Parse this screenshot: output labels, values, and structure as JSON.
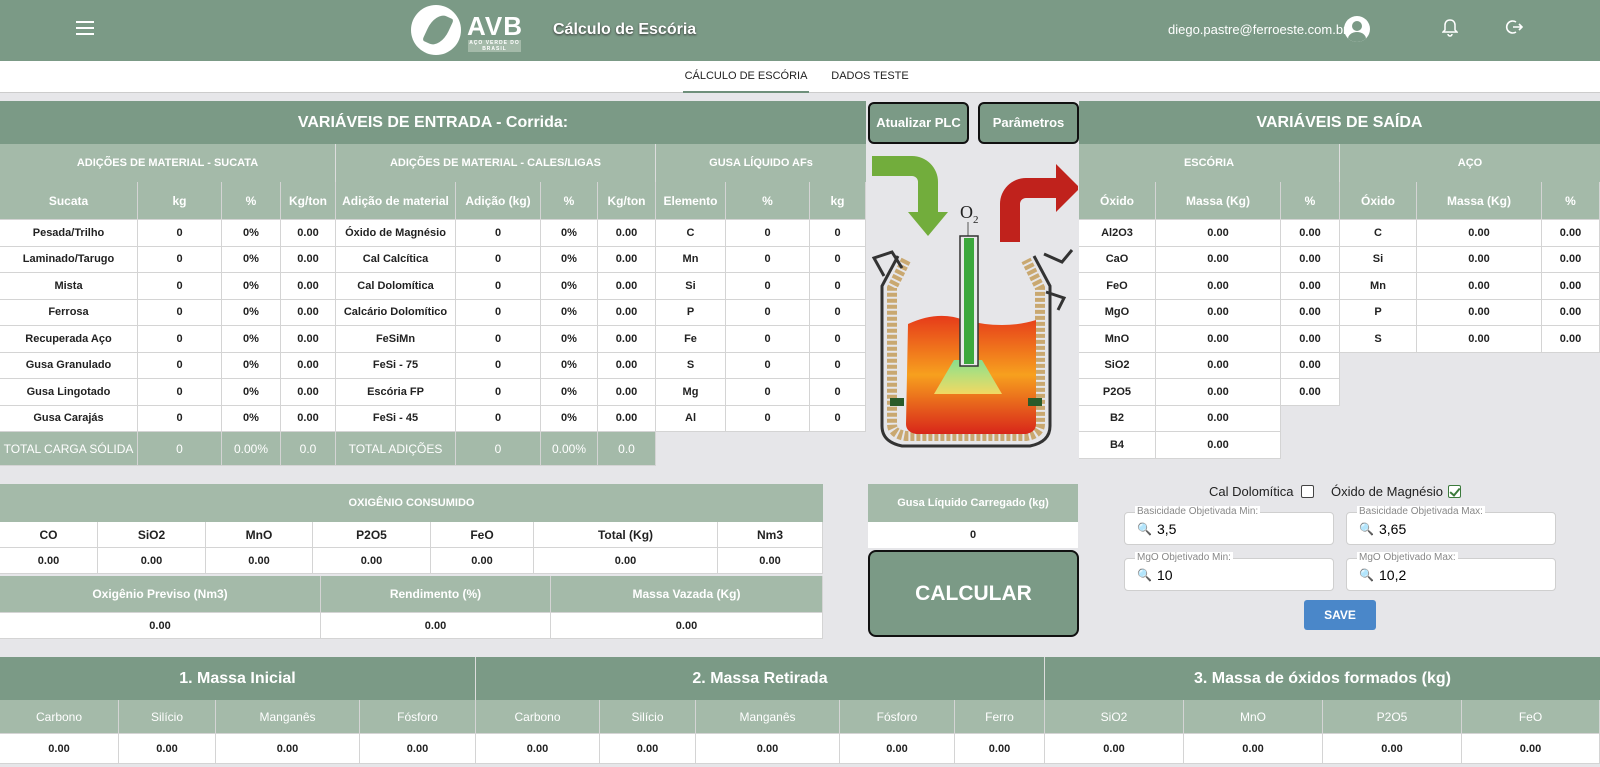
{
  "header": {
    "app_title": "Cálculo de Escória",
    "brand": "AVB",
    "brand_sub": "AÇO VERDE DO BRASIL",
    "user_email": "diego.pastre@ferroeste.com.br"
  },
  "tabs": [
    {
      "label": "CÁLCULO DE ESCÓRIA"
    },
    {
      "label": "DADOS TESTE"
    }
  ],
  "inputs": {
    "title": "VARIÁVEIS DE ENTRADA - Corrida:",
    "sucata": {
      "title": "ADIÇÕES DE MATERIAL - SUCATA",
      "cols": [
        "Sucata",
        "kg",
        "%",
        "Kg/ton"
      ],
      "rows": [
        [
          "Pesada/Trilho",
          "0",
          "0%",
          "0.00"
        ],
        [
          "Laminado/Tarugo",
          "0",
          "0%",
          "0.00"
        ],
        [
          "Mista",
          "0",
          "0%",
          "0.00"
        ],
        [
          "Ferrosa",
          "0",
          "0%",
          "0.00"
        ],
        [
          "Recuperada Aço",
          "0",
          "0%",
          "0.00"
        ],
        [
          "Gusa Granulado",
          "0",
          "0%",
          "0.00"
        ],
        [
          "Gusa Lingotado",
          "0",
          "0%",
          "0.00"
        ],
        [
          "Gusa Carajás",
          "0",
          "0%",
          "0.00"
        ]
      ],
      "total": [
        "TOTAL CARGA SÓLIDA",
        "0",
        "0.00%",
        "0.0"
      ]
    },
    "cales": {
      "title": "ADIÇÕES DE MATERIAL - CALES/LIGAS",
      "cols": [
        "Adição de material",
        "Adição (kg)",
        "%",
        "Kg/ton"
      ],
      "rows": [
        [
          "Óxido de Magnésio",
          "0",
          "0%",
          "0.00"
        ],
        [
          "Cal Calcítica",
          "0",
          "0%",
          "0.00"
        ],
        [
          "Cal Dolomítica",
          "0",
          "0%",
          "0.00"
        ],
        [
          "Calcário Dolomítico",
          "0",
          "0%",
          "0.00"
        ],
        [
          "FeSiMn",
          "0",
          "0%",
          "0.00"
        ],
        [
          "FeSi - 75",
          "0",
          "0%",
          "0.00"
        ],
        [
          "Escória FP",
          "0",
          "0%",
          "0.00"
        ],
        [
          "FeSi - 45",
          "0",
          "0%",
          "0.00"
        ]
      ],
      "total": [
        "TOTAL ADIÇÕES",
        "0",
        "0.00%",
        "0.0"
      ]
    },
    "gusa": {
      "title": "GUSA LÍQUIDO AFs",
      "cols": [
        "Elemento",
        "%",
        "kg"
      ],
      "rows": [
        [
          "C",
          "0",
          "0"
        ],
        [
          "Mn",
          "0",
          "0"
        ],
        [
          "Si",
          "0",
          "0"
        ],
        [
          "P",
          "0",
          "0"
        ],
        [
          "Fe",
          "0",
          "0"
        ],
        [
          "S",
          "0",
          "0"
        ],
        [
          "Mg",
          "0",
          "0"
        ],
        [
          "Al",
          "0",
          "0"
        ]
      ]
    }
  },
  "buttons": {
    "plc": "Atualizar PLC",
    "params": "Parâmetros",
    "calc": "CALCULAR",
    "save": "SAVE"
  },
  "furnace": {
    "o2_label": "O",
    "o2_sub": "2"
  },
  "outputs": {
    "title": "VARIÁVEIS DE SAÍDA",
    "escoria": {
      "title": "ESCÓRIA",
      "cols": [
        "Óxido",
        "Massa (Kg)",
        "%"
      ],
      "rows": [
        [
          "Al2O3",
          "0.00",
          "0.00"
        ],
        [
          "CaO",
          "0.00",
          "0.00"
        ],
        [
          "FeO",
          "0.00",
          "0.00"
        ],
        [
          "MgO",
          "0.00",
          "0.00"
        ],
        [
          "MnO",
          "0.00",
          "0.00"
        ],
        [
          "SiO2",
          "0.00",
          "0.00"
        ],
        [
          "P2O5",
          "0.00",
          "0.00"
        ]
      ],
      "extra": [
        [
          "B2",
          "0.00"
        ],
        [
          "B4",
          "0.00"
        ]
      ]
    },
    "aco": {
      "title": "AÇO",
      "cols": [
        "Óxido",
        "Massa (Kg)",
        "%"
      ],
      "rows": [
        [
          "C",
          "0.00",
          "0.00"
        ],
        [
          "Si",
          "0.00",
          "0.00"
        ],
        [
          "Mn",
          "0.00",
          "0.00"
        ],
        [
          "P",
          "0.00",
          "0.00"
        ],
        [
          "S",
          "0.00",
          "0.00"
        ]
      ]
    }
  },
  "oxigenio": {
    "title": "OXIGÊNIO CONSUMIDO",
    "cols": [
      "CO",
      "SiO2",
      "MnO",
      "P2O5",
      "FeO",
      "Total (Kg)",
      "Nm3"
    ],
    "values": [
      "0.00",
      "0.00",
      "0.00",
      "0.00",
      "0.00",
      "0.00",
      "0.00"
    ],
    "cols2": [
      "Oxigênio Previso (Nm3)",
      "Rendimento (%)",
      "Massa Vazada (Kg)"
    ],
    "values2": [
      "0.00",
      "0.00",
      "0.00"
    ]
  },
  "gusa_carregado": {
    "label": "Gusa Líquido Carregado (kg)",
    "value": "0"
  },
  "params": {
    "cal_dolomitica": {
      "label": "Cal Dolomítica",
      "checked": false
    },
    "oxido_magnesio": {
      "label": "Óxido de Magnésio",
      "checked": true
    },
    "basic_min": {
      "label": "Basicidade Objetivada Min:",
      "value": "3,5"
    },
    "basic_max": {
      "label": "Basicidade Objetivada Max:",
      "value": "3,65"
    },
    "mgo_min": {
      "label": "MgO Objetivado Min:",
      "value": "10"
    },
    "mgo_max": {
      "label": "MgO Objetivado Max:",
      "value": "10,2"
    }
  },
  "bottom": {
    "s1": {
      "title": "1. Massa Inicial",
      "cols": [
        "Carbono",
        "Silício",
        "Manganês",
        "Fósforo"
      ],
      "values": [
        "0.00",
        "0.00",
        "0.00",
        "0.00"
      ]
    },
    "s2": {
      "title": "2. Massa Retirada",
      "cols": [
        "Carbono",
        "Silício",
        "Manganês",
        "Fósforo",
        "Ferro"
      ],
      "values": [
        "0.00",
        "0.00",
        "0.00",
        "0.00",
        "0.00"
      ]
    },
    "s3": {
      "title": "3. Massa de óxidos formados (kg)",
      "cols": [
        "SiO2",
        "MnO",
        "P2O5",
        "FeO"
      ],
      "values": [
        "0.00",
        "0.00",
        "0.00",
        "0.00"
      ]
    }
  },
  "colors": {
    "primary": "#7b9a86",
    "secondary": "#a4baa9",
    "save_button": "#4a87c9"
  }
}
